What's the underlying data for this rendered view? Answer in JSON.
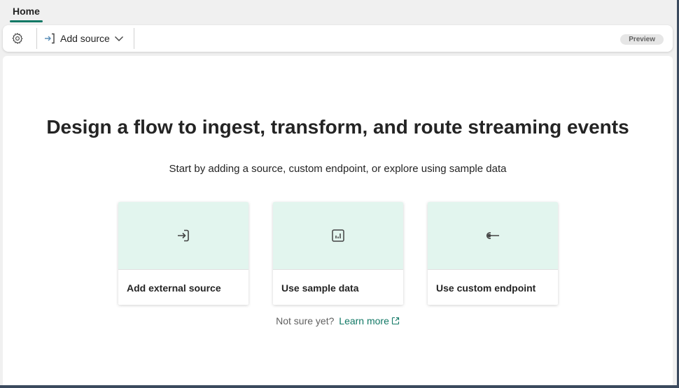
{
  "tabs": [
    {
      "label": "Home",
      "active": true
    }
  ],
  "toolbar": {
    "settings_icon": "gear-icon",
    "add_source_label": "Add source",
    "add_source_icon": "arrow-into-bracket-icon",
    "badge": "Preview"
  },
  "main": {
    "title": "Design a flow to ingest, transform, and route streaming events",
    "subtitle": "Start by adding a source, custom endpoint, or explore using sample data",
    "cards": [
      {
        "label": "Add external source",
        "icon": "sign-in-arrow-icon"
      },
      {
        "label": "Use sample data",
        "icon": "bar-chart-icon"
      },
      {
        "label": "Use custom endpoint",
        "icon": "endpoint-icon"
      }
    ],
    "footer_text": "Not sure yet?",
    "learn_more": "Learn more"
  },
  "colors": {
    "accent": "#117865",
    "card_top": "#e2f5ee"
  }
}
